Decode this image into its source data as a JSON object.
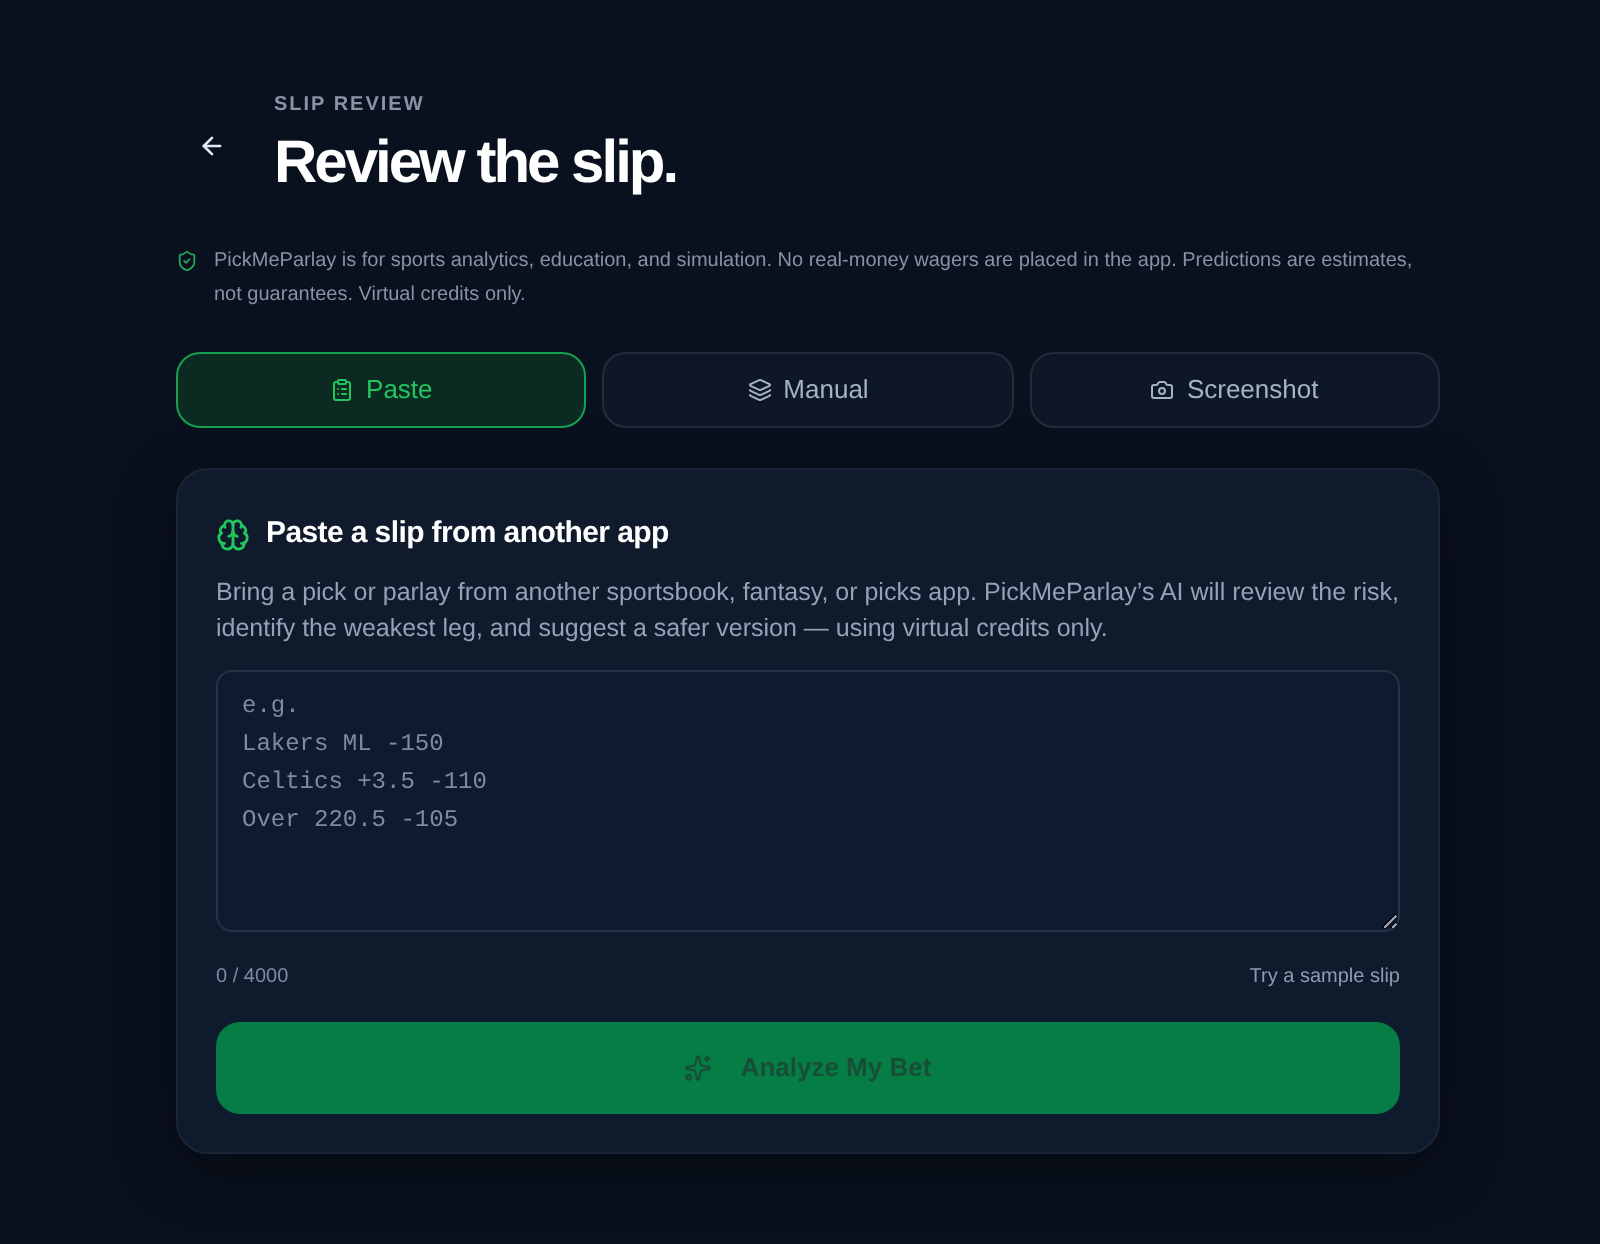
{
  "header": {
    "eyebrow": "SLIP REVIEW",
    "title": "Review the slip."
  },
  "disclaimer": "PickMeParlay is for sports analytics, education, and simulation. No real-money wagers are placed in the app. Predictions are estimates, not guarantees. Virtual credits only.",
  "tabs": [
    {
      "label": "Paste",
      "selected": true
    },
    {
      "label": "Manual",
      "selected": false
    },
    {
      "label": "Screenshot",
      "selected": false
    }
  ],
  "card": {
    "title": "Paste a slip from another app",
    "description": "Bring a pick or parlay from another sportsbook, fantasy, or picks app. PickMeParlay’s AI will review the risk, identify the weakest leg, and suggest a safer version — using virtual credits only.",
    "input": {
      "placeholder": "e.g.\nLakers ML -150\nCeltics +3.5 -110\nOver 220.5 -105"
    },
    "counter": "0 / 4000",
    "sample_link": "Try a sample slip",
    "submit": {
      "label": "Analyze My Bet",
      "disabled": true
    }
  }
}
